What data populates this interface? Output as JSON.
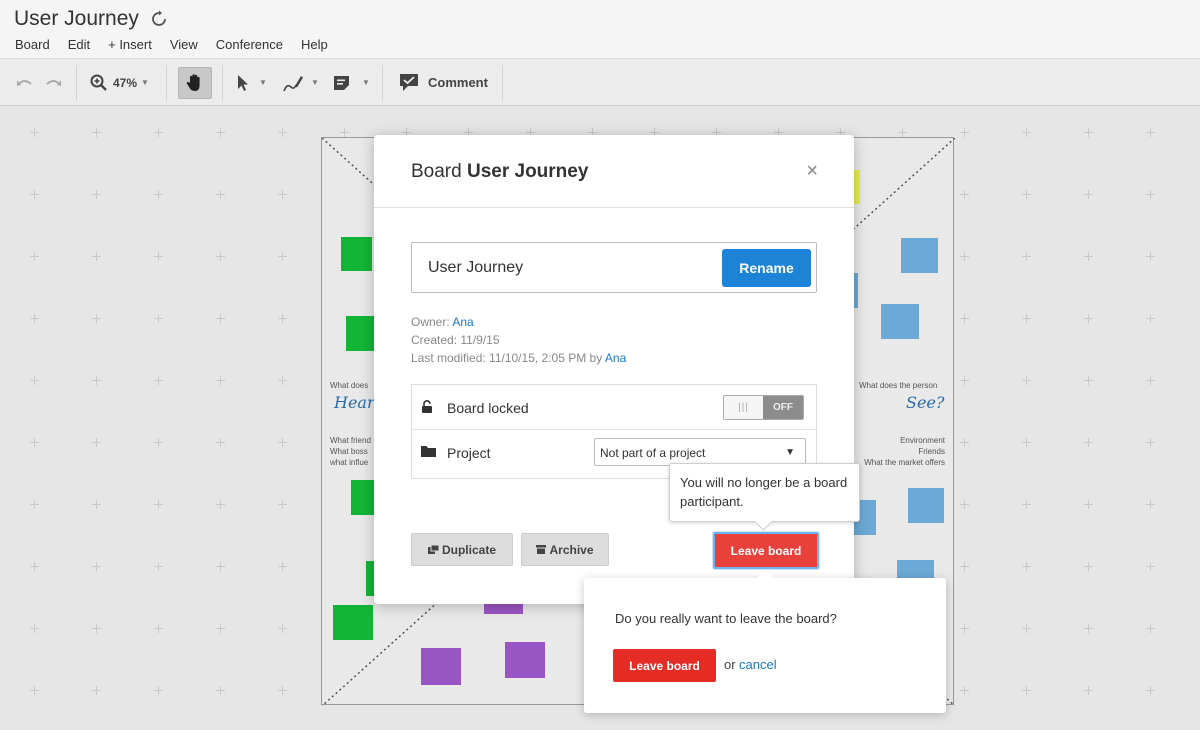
{
  "app": {
    "title": "User Journey",
    "menu": [
      "Board",
      "Edit",
      "+ Insert",
      "View",
      "Conference",
      "Help"
    ]
  },
  "toolbar": {
    "zoom": "47%",
    "comment_label": "Comment"
  },
  "board_canvas": {
    "left_text_top": "What does",
    "left_big": "Hear?",
    "left_list": [
      "What friend",
      "What boss",
      "what influe"
    ],
    "right_text_top": "What does the person",
    "right_big": "See?",
    "right_list": [
      "Environment",
      "Friends",
      "What the market offers"
    ],
    "colors": {
      "green": "#12b536",
      "blue": "#6ca9d6",
      "purple": "#9a55c4",
      "yellow": "#e6ee4c"
    }
  },
  "modal": {
    "title_prefix": "Board",
    "title_name": "User Journey",
    "close": "×",
    "name_value": "User Journey",
    "rename_label": "Rename",
    "owner_label": "Owner:",
    "owner_name": "Ana",
    "created": "Created: 11/9/15",
    "modified_label": "Last modified: 11/10/15, 2:05 PM by",
    "modified_by": "Ana",
    "locked_label": "Board locked",
    "toggle_state": "OFF",
    "project_label": "Project",
    "project_value": "Not part of a project",
    "duplicate_label": "Duplicate",
    "archive_label": "Archive",
    "leave_label": "Leave board"
  },
  "tooltip": {
    "text": "You will no longer be a board participant."
  },
  "confirm": {
    "question": "Do you really want to leave the board?",
    "leave_label": "Leave board",
    "or": "or",
    "cancel": "cancel"
  }
}
